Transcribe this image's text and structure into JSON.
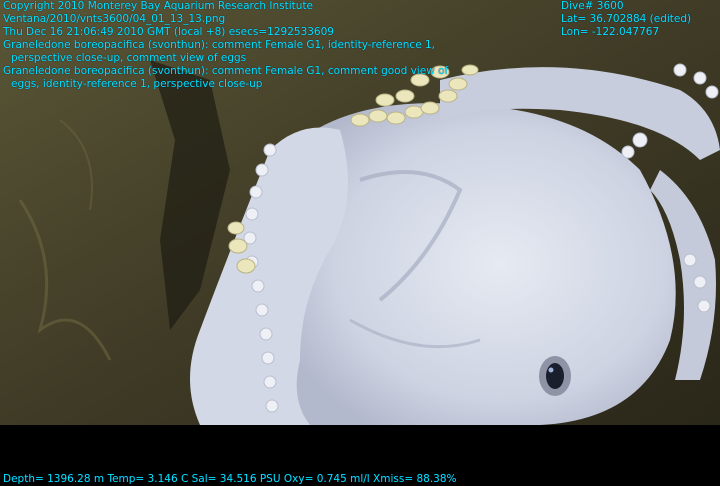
{
  "overlay": {
    "copyright": "Copyright 2010 Monterey Bay Aquarium Research Institute",
    "file_path": "Ventana/2010/vnts3600/04_01_13_13.png",
    "timestamp": "Thu Dec 16 21:06:49 2010 GMT (local +8)  esecs=1292533609",
    "annotation_1_line_1": "Graneledone boreopacifica (svonthun): comment Female G1, identity-reference 1,",
    "annotation_1_line_2": "perspective close-up, comment view of eggs",
    "annotation_2_line_1": "Graneledone boreopacifica (svonthun): comment Female G1, comment good view of",
    "annotation_2_line_2": "eggs, identity-reference 1, perspective close-up",
    "dive": "Dive# 3600",
    "lat": "Lat= 36.702884 (edited)",
    "lon": "Lon= -122.047767",
    "sensors": "Depth= 1396.28 m  Temp= 3.146 C  Sal= 34.516 PSU  Oxy= 0.745 ml/l  Xmiss= 88.38%"
  },
  "colors": {
    "overlay_text": "#00e5ff",
    "rock": "#4a4630",
    "octopus": "#d6dce8",
    "eggs": "#e9e4b8",
    "letterbox": "#000000"
  }
}
